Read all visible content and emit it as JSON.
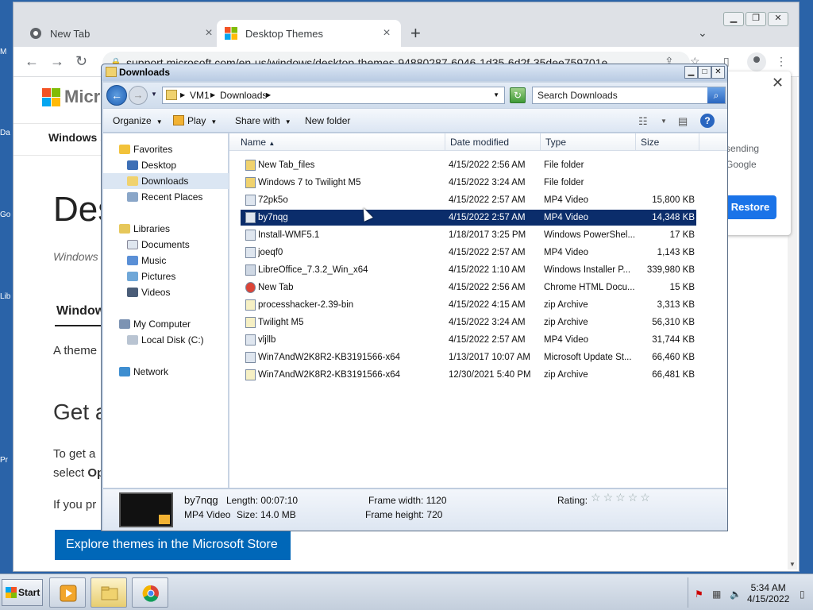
{
  "desktop": {
    "edge_labels": [
      "M",
      "Da",
      "Go",
      "Lib",
      "Pr"
    ]
  },
  "chrome": {
    "tabs": [
      {
        "label": "New Tab",
        "icon": "chrome-icon",
        "active": false
      },
      {
        "label": "Desktop Themes",
        "icon": "microsoft-icon",
        "active": true
      }
    ],
    "url": "support.microsoft.com/en-us/windows/desktop-themes-94880287-6046-1d35-6d2f-35dee759701e"
  },
  "page": {
    "brand": "Micro",
    "nav_item": "Windows s",
    "h1": "Des",
    "crumb": "Windows",
    "h2": "Window",
    "p1": "A theme",
    "h3": "Get a",
    "p2a": "To get a",
    "p2b": "select",
    "p2b_bold": "Op",
    "p3": "If you pr",
    "store_button": "Explore themes in the Microsoft Store"
  },
  "restore_popup": {
    "line1": "sending",
    "line2": "Google",
    "button": "Restore"
  },
  "explorer": {
    "title": "Downloads",
    "breadcrumb": [
      "VM1",
      "Downloads"
    ],
    "search_placeholder": "Search Downloads",
    "commands": {
      "organize": "Organize",
      "play": "Play",
      "share": "Share with",
      "new_folder": "New folder"
    },
    "nav": {
      "favorites": "Favorites",
      "desktop": "Desktop",
      "downloads": "Downloads",
      "recent": "Recent Places",
      "libraries": "Libraries",
      "documents": "Documents",
      "music": "Music",
      "pictures": "Pictures",
      "videos": "Videos",
      "computer": "My Computer",
      "local_disk": "Local Disk (C:)",
      "network": "Network"
    },
    "columns": {
      "name": "Name",
      "date": "Date modified",
      "type": "Type",
      "size": "Size"
    },
    "files": [
      {
        "name": "New Tab_files",
        "date": "4/15/2022 2:56 AM",
        "type": "File folder",
        "size": "",
        "icon": "folder-icon"
      },
      {
        "name": "Windows 7 to Twilight M5",
        "date": "4/15/2022 3:24 AM",
        "type": "File folder",
        "size": "",
        "icon": "folder-icon"
      },
      {
        "name": "72pk5o",
        "date": "4/15/2022 2:57 AM",
        "type": "MP4 Video",
        "size": "15,800 KB",
        "icon": "video-file-icon"
      },
      {
        "name": "by7nqg",
        "date": "4/15/2022 2:57 AM",
        "type": "MP4 Video",
        "size": "14,348 KB",
        "icon": "video-file-icon",
        "selected": true
      },
      {
        "name": "Install-WMF5.1",
        "date": "1/18/2017 3:25 PM",
        "type": "Windows PowerShel...",
        "size": "17 KB",
        "icon": "script-file-icon"
      },
      {
        "name": "joeqf0",
        "date": "4/15/2022 2:57 AM",
        "type": "MP4 Video",
        "size": "1,143 KB",
        "icon": "video-file-icon"
      },
      {
        "name": "LibreOffice_7.3.2_Win_x64",
        "date": "4/15/2022 1:10 AM",
        "type": "Windows Installer P...",
        "size": "339,980 KB",
        "icon": "installer-file-icon"
      },
      {
        "name": "New Tab",
        "date": "4/15/2022 2:56 AM",
        "type": "Chrome HTML Docu...",
        "size": "15 KB",
        "icon": "chrome-file-icon"
      },
      {
        "name": "processhacker-2.39-bin",
        "date": "4/15/2022 4:15 AM",
        "type": "zip Archive",
        "size": "3,313 KB",
        "icon": "zip-file-icon"
      },
      {
        "name": "Twilight M5",
        "date": "4/15/2022 3:24 AM",
        "type": "zip Archive",
        "size": "56,310 KB",
        "icon": "zip-file-icon"
      },
      {
        "name": "vljllb",
        "date": "4/15/2022 2:57 AM",
        "type": "MP4 Video",
        "size": "31,744 KB",
        "icon": "video-file-icon"
      },
      {
        "name": "Win7AndW2K8R2-KB3191566-x64",
        "date": "1/13/2017 10:07 AM",
        "type": "Microsoft Update St...",
        "size": "66,460 KB",
        "icon": "update-file-icon"
      },
      {
        "name": "Win7AndW2K8R2-KB3191566-x64",
        "date": "12/30/2021 5:40 PM",
        "type": "zip Archive",
        "size": "66,481 KB",
        "icon": "zip-file-icon"
      }
    ],
    "details": {
      "name": "by7nqg",
      "kind": "MP4 Video",
      "length_label": "Length:",
      "length": "00:07:10",
      "size_label": "Size:",
      "size": "14.0 MB",
      "fw_label": "Frame width:",
      "frame_width": "1120",
      "fh_label": "Frame height:",
      "frame_height": "720",
      "rating_label": "Rating:",
      "rating": 0,
      "rating_max": 5
    }
  },
  "taskbar": {
    "start": "Start",
    "time": "5:34 AM",
    "date": "4/15/2022"
  },
  "colors": {
    "selection": "#0b2d6b",
    "restore_button": "#1a73e8",
    "store_button": "#0067b8",
    "desktop": "#2a63a8"
  }
}
